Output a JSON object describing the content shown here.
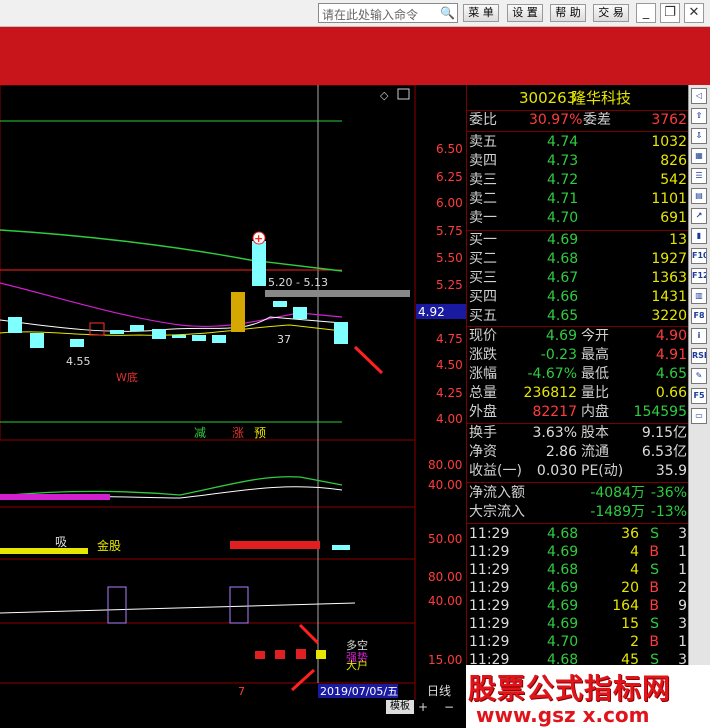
{
  "toolbar": {
    "command_placeholder": "请在此处输入命令",
    "menu": "菜 单",
    "settings": "设 置",
    "help": "帮 助",
    "trade": "交 易"
  },
  "chart": {
    "yaxis_main": [
      "6.50",
      "6.25",
      "6.00",
      "5.75",
      "5.50",
      "5.25",
      "5.00",
      "4.75",
      "4.50",
      "4.25",
      "4.00"
    ],
    "current_price": "4.92",
    "range_label": "5.20 - 5.13",
    "low_label": "4.55",
    "count_label": "37",
    "w_label": "W底",
    "signal_reduce": "减",
    "signal_rise": "涨",
    "signal_warn": "预",
    "panel2_axis": [
      "80.00",
      "40.00"
    ],
    "panel3_axis": [
      "50.00"
    ],
    "panel3_suck": "吸",
    "panel3_gold": "金股",
    "panel4_axis": [
      "80.00",
      "40.00"
    ],
    "panel5_axis": [
      "15.00"
    ],
    "legend_long_short": "多空",
    "legend_strength": "强势",
    "legend_big": "大户",
    "xlabel_7": "7",
    "date_label": "2019/07/05/五",
    "period": "日线",
    "template": "模板"
  },
  "quote": {
    "code": "300263",
    "name": "隆华科技",
    "wb_label": "委比",
    "wb": "30.97%",
    "wc_label": "委差",
    "wc": "3762",
    "asks": [
      {
        "l": "卖五",
        "p": "4.74",
        "v": "1032"
      },
      {
        "l": "卖四",
        "p": "4.73",
        "v": "826"
      },
      {
        "l": "卖三",
        "p": "4.72",
        "v": "542"
      },
      {
        "l": "卖二",
        "p": "4.71",
        "v": "1101"
      },
      {
        "l": "卖一",
        "p": "4.70",
        "v": "691"
      }
    ],
    "bids": [
      {
        "l": "买一",
        "p": "4.69",
        "v": "13"
      },
      {
        "l": "买二",
        "p": "4.68",
        "v": "1927"
      },
      {
        "l": "买三",
        "p": "4.67",
        "v": "1363"
      },
      {
        "l": "买四",
        "p": "4.66",
        "v": "1431"
      },
      {
        "l": "买五",
        "p": "4.65",
        "v": "3220"
      }
    ],
    "stats": [
      {
        "l1": "现价",
        "v1": "4.69",
        "c1": "g",
        "l2": "今开",
        "v2": "4.90",
        "c2": "rd"
      },
      {
        "l1": "涨跌",
        "v1": "-0.23",
        "c1": "g",
        "l2": "最高",
        "v2": "4.91",
        "c2": "rd"
      },
      {
        "l1": "涨幅",
        "v1": "-4.67%",
        "c1": "g",
        "l2": "最低",
        "v2": "4.65",
        "c2": "g"
      },
      {
        "l1": "总量",
        "v1": "236812",
        "c1": "y",
        "l2": "量比",
        "v2": "0.66",
        "c2": "y"
      },
      {
        "l1": "外盘",
        "v1": "82217",
        "c1": "rd",
        "l2": "内盘",
        "v2": "154595",
        "c2": "g"
      }
    ],
    "stats2": [
      {
        "l1": "换手",
        "v1": "3.63%",
        "l2": "股本",
        "v2": "9.15亿"
      },
      {
        "l1": "净资",
        "v1": "2.86",
        "l2": "流通",
        "v2": "6.53亿"
      },
      {
        "l1": "收益(一)",
        "v1": "0.030",
        "l2": "PE(动)",
        "v2": "35.9"
      }
    ],
    "flow": [
      {
        "l": "净流入额",
        "v": "-4084万",
        "p": "-36%"
      },
      {
        "l": "大宗流入",
        "v": "-1489万",
        "p": "-13%"
      }
    ],
    "ticks": [
      {
        "t": "11:29",
        "p": "4.68",
        "pc": "g",
        "v": "36",
        "s": "S",
        "n": "3"
      },
      {
        "t": "11:29",
        "p": "4.69",
        "pc": "g",
        "v": "4",
        "s": "B",
        "n": "1"
      },
      {
        "t": "11:29",
        "p": "4.68",
        "pc": "g",
        "v": "4",
        "s": "S",
        "n": "1"
      },
      {
        "t": "11:29",
        "p": "4.69",
        "pc": "g",
        "v": "20",
        "s": "B",
        "n": "2"
      },
      {
        "t": "11:29",
        "p": "4.69",
        "pc": "g",
        "v": "164",
        "s": "B",
        "n": "9"
      },
      {
        "t": "11:29",
        "p": "4.69",
        "pc": "g",
        "v": "15",
        "s": "S",
        "n": "3"
      },
      {
        "t": "11:29",
        "p": "4.70",
        "pc": "g",
        "v": "2",
        "s": "B",
        "n": "1"
      },
      {
        "t": "11:29",
        "p": "4.68",
        "pc": "g",
        "v": "45",
        "s": "S",
        "n": "3"
      }
    ]
  },
  "right_tools": [
    "RSI",
    "F12",
    "F5",
    "F10",
    "F8"
  ],
  "watermark": {
    "cn": "股票公式指标网",
    "url": "www.gsz x.com"
  }
}
